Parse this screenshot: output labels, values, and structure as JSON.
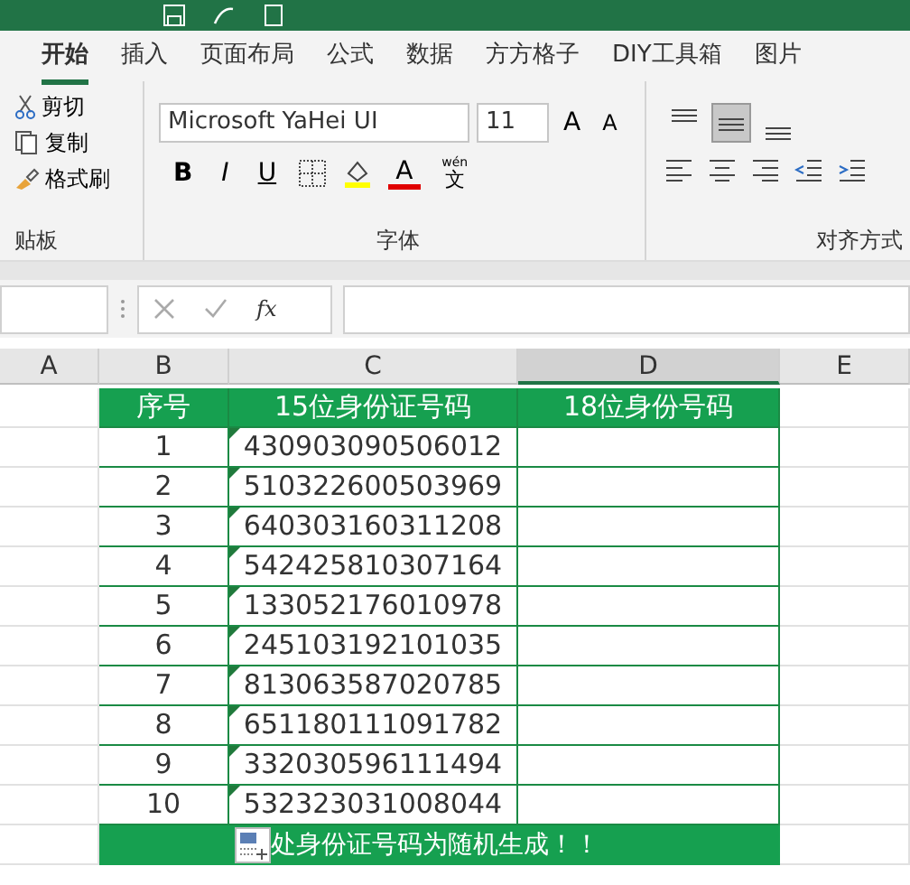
{
  "ribbon_tabs": [
    {
      "label": "开始",
      "selected": true
    },
    {
      "label": "插入",
      "selected": false
    },
    {
      "label": "页面布局",
      "selected": false
    },
    {
      "label": "公式",
      "selected": false
    },
    {
      "label": "数据",
      "selected": false
    },
    {
      "label": "方方格子",
      "selected": false
    },
    {
      "label": "DIY工具箱",
      "selected": false
    },
    {
      "label": "图片",
      "selected": false
    }
  ],
  "clipboard": {
    "cut": "剪切",
    "copy": "复制",
    "format_painter": "格式刷",
    "group_label": "贴板"
  },
  "font": {
    "name": "Microsoft YaHei UI",
    "size": "11",
    "grow": "A",
    "shrink": "A",
    "bold": "B",
    "italic": "I",
    "underline": "U",
    "font_color": "A",
    "phonetic_ruby": "wén",
    "phonetic_base": "文",
    "group_label": "字体"
  },
  "alignment": {
    "vertical": [
      {
        "selected": false
      },
      {
        "selected": true
      },
      {
        "selected": false
      }
    ],
    "group_label": "对齐方式"
  },
  "formula_bar": {
    "function_label": "fx"
  },
  "sheet": {
    "columns": [
      {
        "label": "A",
        "selected": false
      },
      {
        "label": "B",
        "selected": false
      },
      {
        "label": "C",
        "selected": false
      },
      {
        "label": "D",
        "selected": true
      },
      {
        "label": "E",
        "selected": false
      }
    ],
    "header": [
      "序号",
      "15位身份证号码",
      "18位身份号码"
    ],
    "rows": [
      {
        "number": "1",
        "id15": "430903090506012"
      },
      {
        "number": "2",
        "id15": "510322600503969"
      },
      {
        "number": "3",
        "id15": "640303160311208"
      },
      {
        "number": "4",
        "id15": "542425810307164"
      },
      {
        "number": "5",
        "id15": "133052176010978"
      },
      {
        "number": "6",
        "id15": "245103192101035"
      },
      {
        "number": "7",
        "id15": "813063587020785"
      },
      {
        "number": "8",
        "id15": "651180111091782"
      },
      {
        "number": "9",
        "id15": "332030596111494"
      },
      {
        "number": "10",
        "id15": "532323031008044"
      }
    ],
    "note": "处身份证号码为随机生成！！"
  }
}
